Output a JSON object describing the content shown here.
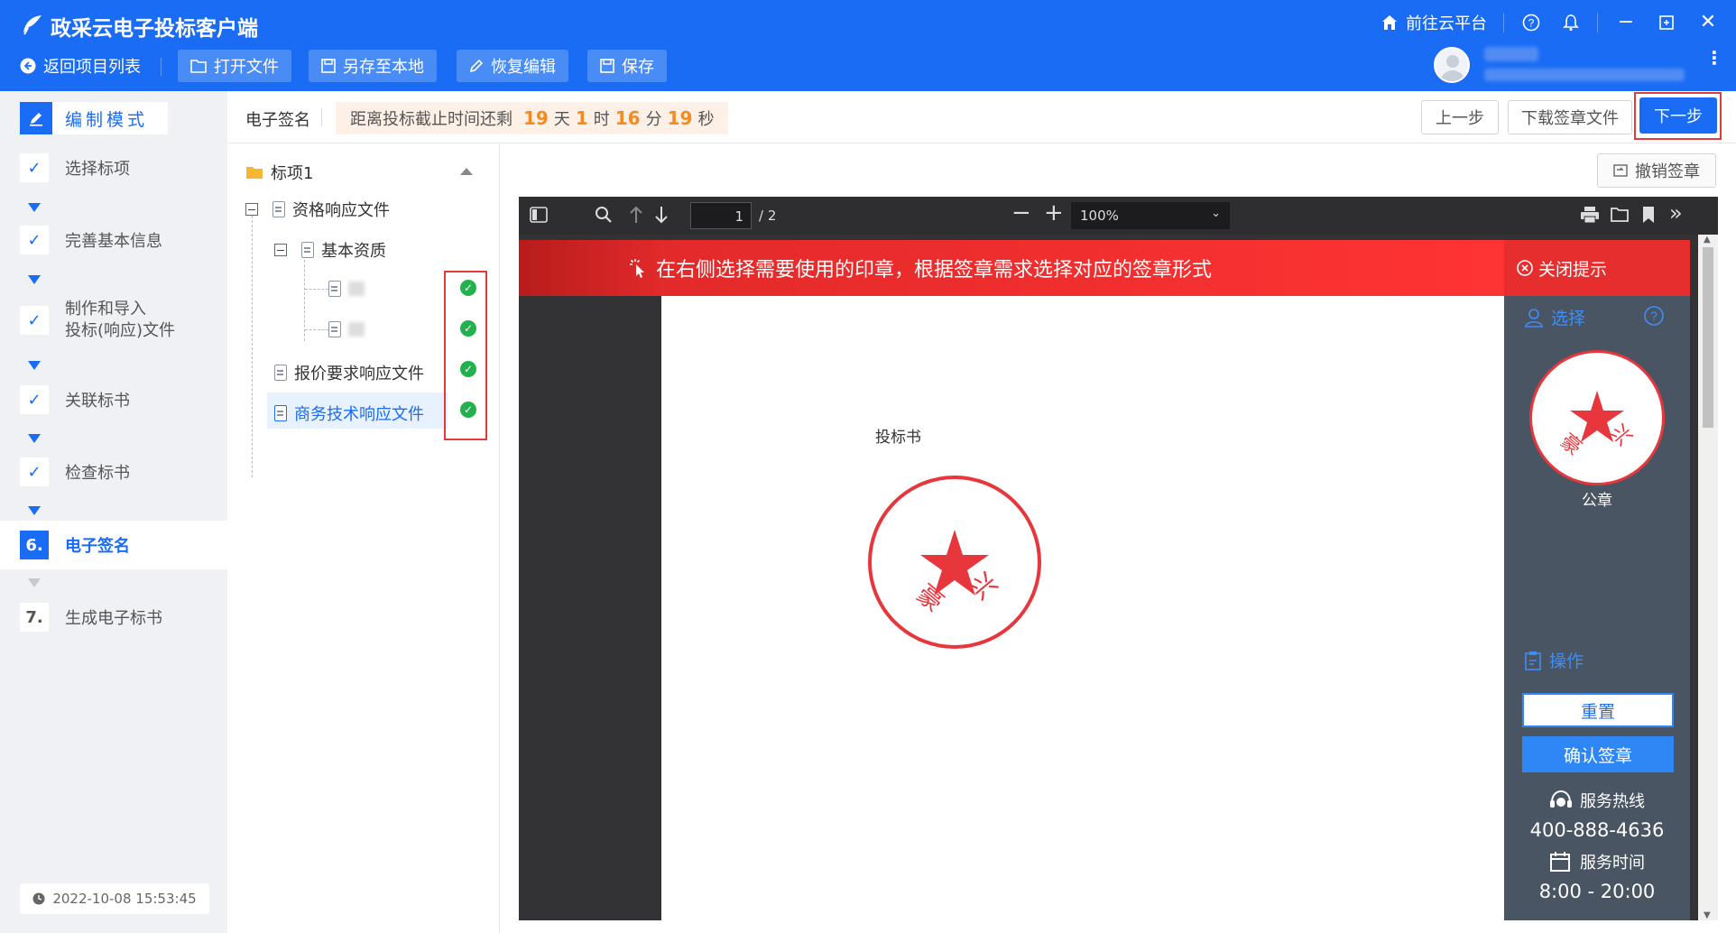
{
  "window": {
    "title": "政采云电子投标客户端",
    "cloud_link": "前往云平台"
  },
  "toolbar": {
    "back_label": "返回项目列表",
    "open_file": "打开文件",
    "save_local": "另存至本地",
    "restore_edit": "恢复编辑",
    "save": "保存"
  },
  "sidebar": {
    "mode_label": "编制模式",
    "steps": [
      {
        "label": "选择标项",
        "done": true
      },
      {
        "label": "完善基本信息",
        "done": true
      },
      {
        "label": "制作和导入",
        "label2": "投标(响应)文件",
        "done": true
      },
      {
        "label": "关联标书",
        "done": true
      },
      {
        "label": "检查标书",
        "done": true
      },
      {
        "label": "电子签名",
        "num": "6.",
        "active": true
      },
      {
        "label": "生成电子标书",
        "num": "7."
      }
    ],
    "datetime": "2022-10-08 15:53:45"
  },
  "header": {
    "title": "电子签名",
    "countdown_prefix": "距离投标截止时间还剩",
    "days": "19",
    "days_unit": "天",
    "hours": "1",
    "hours_unit": "时",
    "minutes": "16",
    "minutes_unit": "分",
    "seconds": "19",
    "seconds_unit": "秒",
    "prev": "上一步",
    "download": "下载签章文件",
    "next": "下一步"
  },
  "tree": {
    "root": "标项1",
    "nodes": [
      {
        "label": "资格响应文件"
      },
      {
        "label": "基本资质"
      },
      {
        "label": "报价要求响应文件"
      },
      {
        "label": "商务技术响应文件",
        "selected": true
      }
    ]
  },
  "viewer": {
    "revoke": "撤销签章",
    "page_current": "1",
    "page_total": "/ 2",
    "zoom": "100%",
    "banner": "在右侧选择需要使用的印章，根据签章需求选择对应的签章形式",
    "close_tip": "关闭提示",
    "page_heading": "投标书"
  },
  "side_panel": {
    "select_label": "选择",
    "seal_name": "公章",
    "operate_label": "操作",
    "reset": "重置",
    "confirm": "确认签章",
    "hotline_label": "服务热线",
    "hotline": "400-888-4636",
    "hours_label": "服务时间",
    "hours": "8:00 - 20:00"
  },
  "colors": {
    "primary": "#1a6cf5",
    "accent_orange": "#f58a1f",
    "banner_red": "#f33333",
    "seal_red": "#e8363d",
    "success": "#22b14c"
  }
}
